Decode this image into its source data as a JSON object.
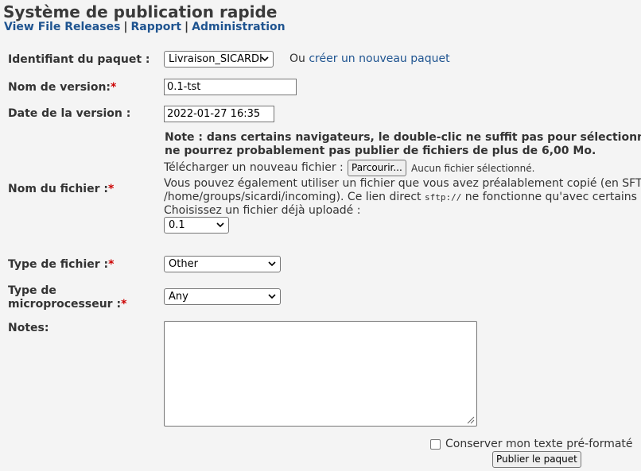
{
  "header": {
    "title": "Système de publication rapide",
    "nav": [
      "View File Releases",
      "Rapport",
      "Administration"
    ],
    "nav_sep": "|"
  },
  "form": {
    "package_label": "Identifiant du paquet :",
    "package_value": "Livraison_SICARDI",
    "or_text": "Ou",
    "create_link": "créer un nouveau paquet",
    "version_label": "Nom de version:",
    "version_value": "0.1-tst",
    "date_label": "Date de la version :",
    "date_value": "2022-01-27 16:35",
    "file_label": "Nom du fichier :",
    "note_line1": "Note : dans certains navigateurs, le double-clic ne suffit pas pour sélectionner",
    "note_line2": "ne pourrez probablement pas publier de fichiers de plus de 6,00 Mo.",
    "upload_label": "Télécharger un nouveau fichier :",
    "browse_button": "Parcourir...",
    "no_file": "Aucun fichier sélectionné.",
    "also_line1": "Vous pouvez également utiliser un fichier que vous avez préalablement copié (en SFT",
    "also_line2a": "/home/groups/sicardi/incoming). Ce lien direct",
    "sftp": "sftp://",
    "also_line2b": "ne fonctionne qu'avec certains",
    "choose_label": "Choisissez un fichier déjà uploadé :",
    "uploaded_value": "0.1",
    "filetype_label": "Type de fichier :",
    "filetype_value": "Other",
    "proc_label_1": "Type de",
    "proc_label_2": "microprocesseur :",
    "proc_value": "Any",
    "notes_label": "Notes:",
    "notes_value": "",
    "keep_format_label": "Conserver mon texte pré-formaté",
    "publish_button": "Publier le paquet",
    "required_mark": "*"
  }
}
